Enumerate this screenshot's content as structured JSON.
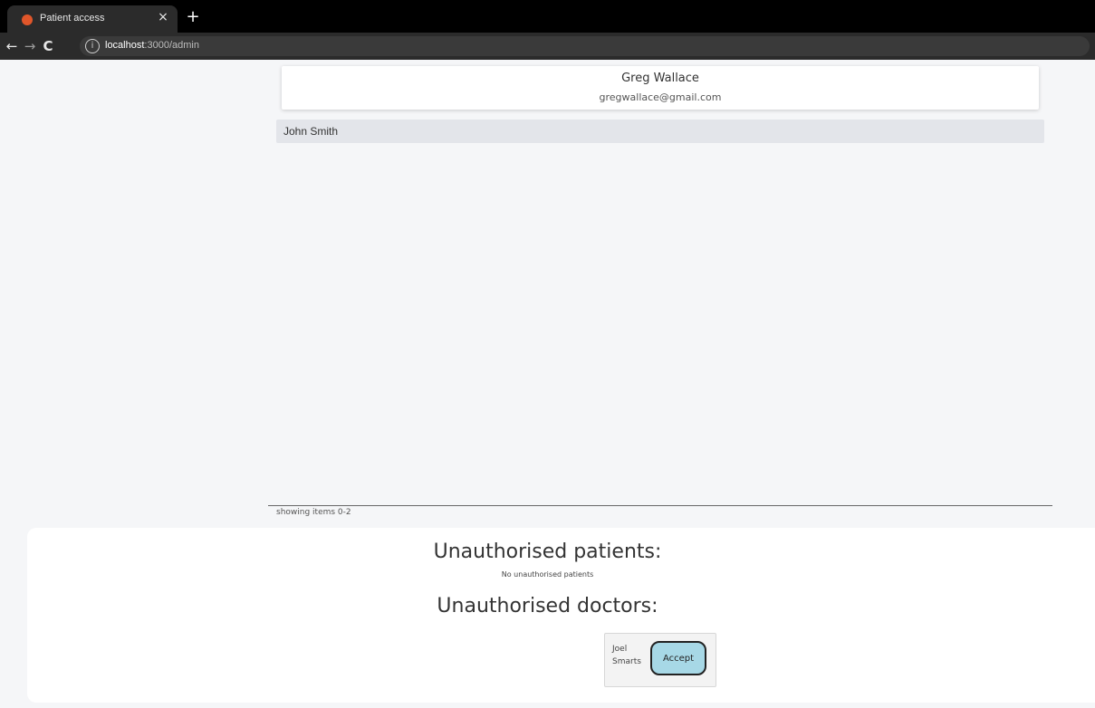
{
  "browser": {
    "tab_title": "Patient access",
    "tab_close": "×",
    "new_tab": "+",
    "url_host": "localhost",
    "url_path": ":3000/admin"
  },
  "profile": {
    "name": "Greg Wallace",
    "email": "gregwallace@gmail.com"
  },
  "list": {
    "items": [
      {
        "name": "John Smith"
      }
    ],
    "footer": "showing items 0-2"
  },
  "unauthorised": {
    "patients_heading": "Unauthorised patients:",
    "patients_empty": "No unauthorised patients",
    "doctors_heading": "Unauthorised doctors:",
    "doctors": [
      {
        "first": "Joel",
        "last": "Smarts",
        "action": "Accept"
      }
    ]
  },
  "colors": {
    "accept_button": "#a7d8e6",
    "list_item_bg": "#e3e5ea",
    "page_bg": "#f5f6f8"
  },
  "icons": {
    "favicon": "brand-logo-icon",
    "back": "arrow-left-icon",
    "forward": "arrow-right-icon",
    "reload": "reload-icon",
    "site_info": "info-icon"
  }
}
